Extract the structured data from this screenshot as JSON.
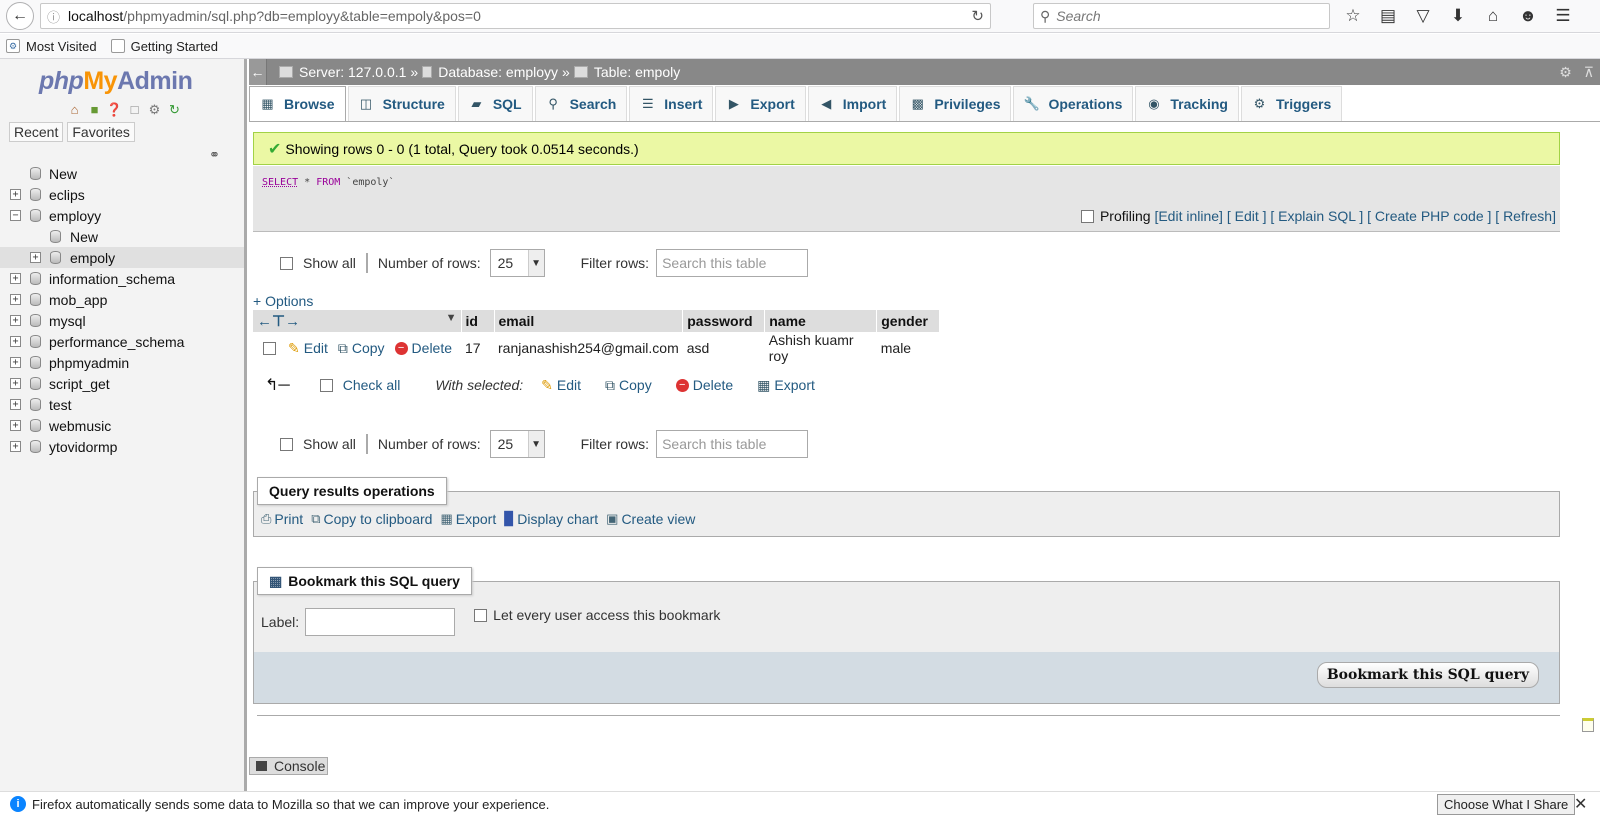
{
  "browser": {
    "url_host": "localhost",
    "url_rest": "/phpmyadmin/sql.php?db=employy&table=empoly&pos=0",
    "search_placeholder": "Search",
    "bookmarks": [
      "Most Visited",
      "Getting Started"
    ]
  },
  "sidebar": {
    "logo_php": "php",
    "logo_my": "My",
    "logo_admin": "Admin",
    "tabs": [
      "Recent",
      "Favorites"
    ],
    "tree": [
      {
        "label": "New",
        "level": 0
      },
      {
        "label": "eclips",
        "level": 0
      },
      {
        "label": "employy",
        "level": 0
      },
      {
        "label": "New",
        "level": 1
      },
      {
        "label": "empoly",
        "level": 1
      },
      {
        "label": "information_schema",
        "level": 0
      },
      {
        "label": "mob_app",
        "level": 0
      },
      {
        "label": "mysql",
        "level": 0
      },
      {
        "label": "performance_schema",
        "level": 0
      },
      {
        "label": "phpmyadmin",
        "level": 0
      },
      {
        "label": "script_get",
        "level": 0
      },
      {
        "label": "test",
        "level": 0
      },
      {
        "label": "webmusic",
        "level": 0
      },
      {
        "label": "ytovidormp",
        "level": 0
      }
    ]
  },
  "breadcrumb": {
    "server": "Server: 127.0.0.1",
    "database": "Database: employy",
    "table": "Table: empoly",
    "sep": "»"
  },
  "tabs": [
    "Browse",
    "Structure",
    "SQL",
    "Search",
    "Insert",
    "Export",
    "Import",
    "Privileges",
    "Operations",
    "Tracking",
    "Triggers"
  ],
  "result": {
    "message": "Showing rows 0 - 0 (1 total, Query took 0.0514 seconds.)",
    "sql_select": "SELECT",
    "sql_star": " * ",
    "sql_from": "FROM",
    "sql_table": " `empoly`",
    "profiling": "Profiling",
    "profiling_links": [
      "[Edit inline]",
      "[ Edit ]",
      "[ Explain SQL ]",
      "[ Create PHP code ]",
      "[ Refresh]"
    ]
  },
  "nav": {
    "show_all": "Show all",
    "num_rows_label": "Number of rows:",
    "num_rows_value": "25",
    "filter_label": "Filter rows:",
    "filter_placeholder": "Search this table"
  },
  "options_link": "+ Options",
  "table": {
    "headers": [
      "id",
      "email",
      "password",
      "name",
      "gender"
    ],
    "rows": [
      {
        "id": "17",
        "email": "ranjanashish254@gmail.com",
        "password": "asd",
        "name": "Ashish kuamr roy",
        "gender": "male"
      }
    ],
    "row_actions": [
      "Edit",
      "Copy",
      "Delete"
    ]
  },
  "with_selected": {
    "check_all": "Check all",
    "label": "With selected:",
    "actions": [
      "Edit",
      "Copy",
      "Delete",
      "Export"
    ]
  },
  "qro": {
    "legend": "Query results operations",
    "links": [
      "Print",
      "Copy to clipboard",
      "Export",
      "Display chart",
      "Create view"
    ]
  },
  "bookmark": {
    "legend": "Bookmark this SQL query",
    "label": "Label:",
    "checkbox": "Let every user access this bookmark",
    "button": "Bookmark this SQL query"
  },
  "console": "Console",
  "notification": {
    "text": "Firefox automatically sends some data to Mozilla so that we can improve your experience.",
    "button": "Choose What I Share"
  }
}
